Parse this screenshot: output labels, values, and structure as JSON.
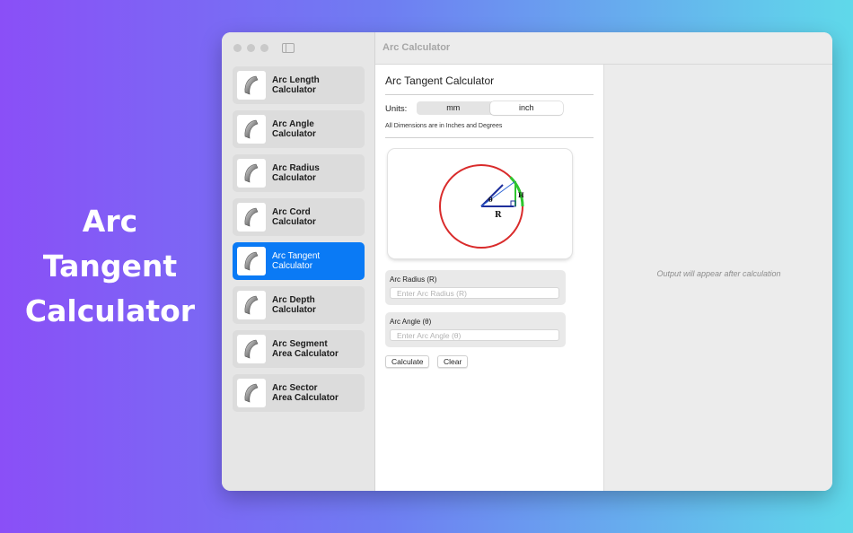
{
  "promo": {
    "line1": "Arc",
    "line2": "Tangent",
    "line3": "Calculator"
  },
  "window": {
    "title": "Arc Calculator"
  },
  "sidebar": {
    "items": [
      {
        "label": "Arc Length\nCalculator",
        "active": false
      },
      {
        "label": "Arc Angle\nCalculator",
        "active": false
      },
      {
        "label": "Arc Radius\nCalculator",
        "active": false
      },
      {
        "label": "Arc Cord\nCalculator",
        "active": false
      },
      {
        "label": "Arc Tangent\nCalculator",
        "active": true
      },
      {
        "label": "Arc Depth\nCalculator",
        "active": false
      },
      {
        "label": "Arc Segment\nArea Calculator",
        "active": false
      },
      {
        "label": "Arc Sector\nArea Calculator",
        "active": false
      }
    ]
  },
  "calculator": {
    "title": "Arc Tangent Calculator",
    "units_label": "Units:",
    "units": [
      "mm",
      "inch"
    ],
    "selected_unit": "inch",
    "note": "All Dimensions are in Inches and Degrees",
    "diagram": {
      "theta_label": "θ",
      "h_label": "H",
      "r_label": "R"
    },
    "radius": {
      "label": "Arc Radius (R)",
      "placeholder": "Enter Arc Radius (R)",
      "value": ""
    },
    "angle": {
      "label": "Arc Angle (θ)",
      "placeholder": "Enter Arc Angle (θ)",
      "value": ""
    },
    "calculate_label": "Calculate",
    "clear_label": "Clear"
  },
  "output": {
    "placeholder": "Output will appear after calculation"
  },
  "colors": {
    "accent": "#0a7af5",
    "circle": "#d92b2b",
    "arc_highlight": "#2ec52e",
    "radius_line": "#1e2f9c"
  }
}
